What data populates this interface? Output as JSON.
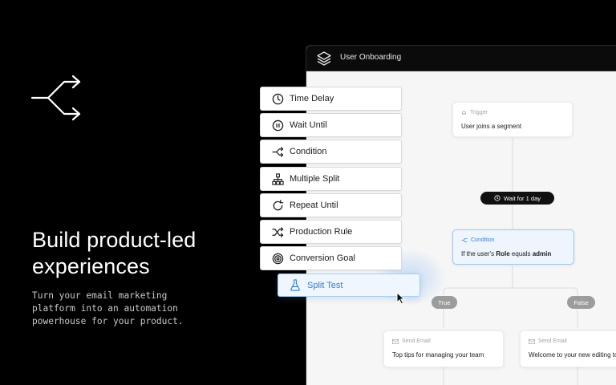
{
  "hero": {
    "headline": "Build product-led experiences",
    "subtext": "Turn your email marketing\nplatform into an automation\npowerhouse for your product.",
    "icon": "split-arrows-icon"
  },
  "app": {
    "title": "User Onboarding",
    "logo_icon": "layers-icon"
  },
  "actions": [
    {
      "label": "Time Delay",
      "icon": "clock-icon"
    },
    {
      "label": "Wait Until",
      "icon": "pause-circle-icon"
    },
    {
      "label": "Condition",
      "icon": "branch-icon"
    },
    {
      "label": "Multiple Split",
      "icon": "hierarchy-icon"
    },
    {
      "label": "Repeat Until",
      "icon": "refresh-icon"
    },
    {
      "label": "Production Rule",
      "icon": "shuffle-icon"
    },
    {
      "label": "Conversion Goal",
      "icon": "target-icon"
    },
    {
      "label": "Split Test",
      "icon": "flask-icon"
    }
  ],
  "flow": {
    "trigger": {
      "kicker": "Trigger",
      "text": "User joins a segment"
    },
    "wait": {
      "label": "Wait for 1 day"
    },
    "condition": {
      "kicker": "Condition",
      "prefix": "If the user's ",
      "field": "Role",
      "middle": " equals ",
      "value": "admin"
    },
    "branch_true": "True",
    "branch_false": "False",
    "email_left": {
      "kicker": "Send Email",
      "text": "Top tips for managing your team"
    },
    "email_right": {
      "kicker": "Send Email",
      "text": "Welcome to your new editing too"
    }
  },
  "colors": {
    "accent": "#3a86d2",
    "background": "#000000",
    "canvas": "#f6f6f7"
  }
}
